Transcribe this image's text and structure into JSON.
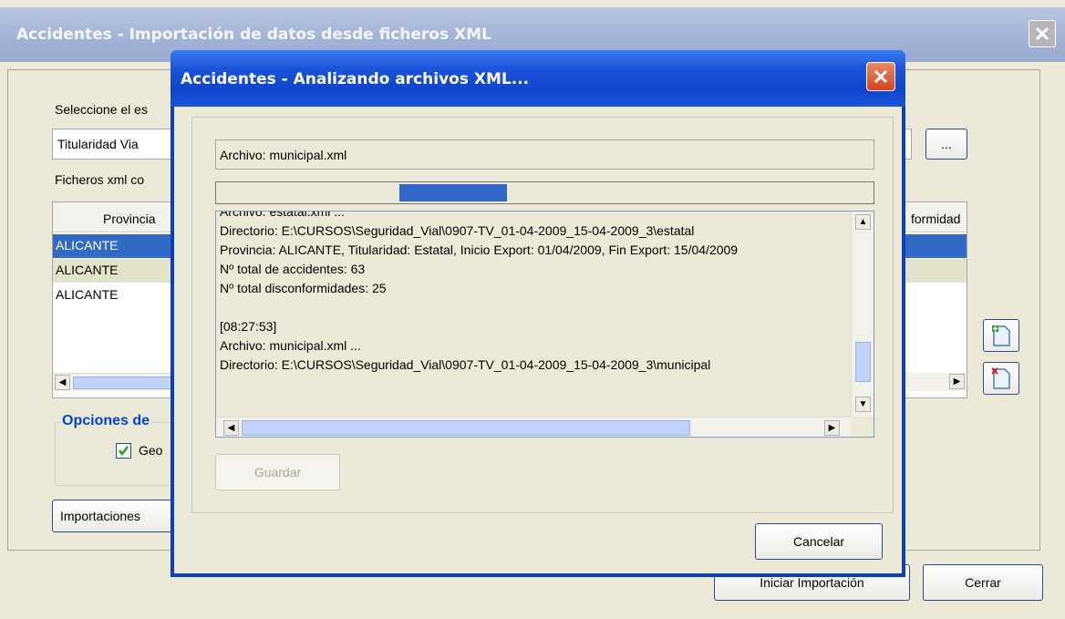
{
  "main_window": {
    "title": "Accidentes - Importación de datos desde ficheros XML",
    "select_label": "Seleccione el es",
    "titularidad_value": "Titularidad Via ",
    "browse_button": "...",
    "files_label": "Ficheros xml co",
    "columns": [
      "Provincia",
      "formidad"
    ],
    "rows": [
      "ALICANTE",
      "ALICANTE",
      "ALICANTE"
    ],
    "options_title": "Opciones de",
    "geo_checkbox_label": "Geo",
    "geo_checked": true,
    "importaciones_button": "Importaciones",
    "iniciar_button": "Iniciar Importación",
    "cerrar_button": "Cerrar",
    "close_icon": "close-icon",
    "add_icon": "add-file-icon",
    "remove_icon": "remove-file-icon"
  },
  "progress_dialog": {
    "title": "Accidentes - Analizando archivos XML...",
    "current_file": "Archivo: municipal.xml",
    "progress_fraction": 0.28,
    "log_lines": [
      "Archivo: estatal.xml ...",
      "Directorio: E:\\CURSOS\\Seguridad_Vial\\0907-TV_01-04-2009_15-04-2009_3\\estatal",
      "Provincia: ALICANTE, Titularidad: Estatal, Inicio Export: 01/04/2009, Fin Export: 15/04/2009",
      "Nº total de accidentes: 63",
      "Nº total disconformidades: 25",
      "",
      "[08:27:53]",
      " Archivo: municipal.xml ...",
      "Directorio: E:\\CURSOS\\Seguridad_Vial\\0907-TV_01-04-2009_15-04-2009_3\\municipal"
    ],
    "guardar_button": "Guardar",
    "cancelar_button": "Cancelar"
  },
  "colors": {
    "title_bar": "#2a5fd0",
    "inactive_title": "#a9b7d6",
    "selection": "#316ac5",
    "row_alt": "#e3e3cb",
    "progress": "#3167c8",
    "close_red": "#d9532c"
  }
}
